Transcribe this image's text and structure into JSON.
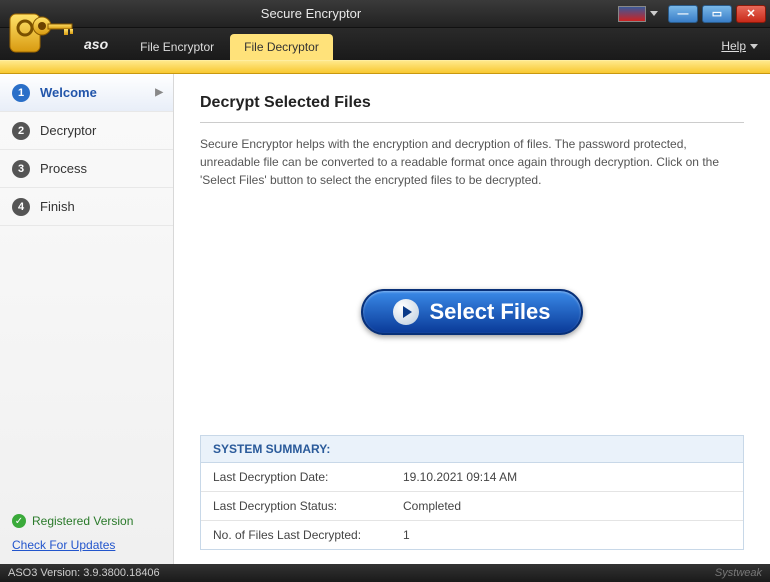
{
  "window": {
    "title": "Secure Encryptor"
  },
  "brand": "aso",
  "tabs": {
    "encryptor": "File Encryptor",
    "decryptor": "File Decryptor"
  },
  "help": "Help",
  "steps": [
    {
      "label": "Welcome"
    },
    {
      "label": "Decryptor"
    },
    {
      "label": "Process"
    },
    {
      "label": "Finish"
    }
  ],
  "sidebar": {
    "registered": "Registered Version",
    "check_updates": "Check For Updates"
  },
  "main": {
    "heading": "Decrypt Selected Files",
    "description": "Secure Encryptor helps with the encryption and decryption of files. The password protected, unreadable file can be converted to a readable format once again through decryption. Click on the 'Select Files' button to select the encrypted files to be decrypted.",
    "select_button": "Select Files"
  },
  "summary": {
    "title": "SYSTEM SUMMARY:",
    "rows": [
      {
        "label": "Last Decryption Date:",
        "value": "19.10.2021 09:14 AM"
      },
      {
        "label": "Last Decryption Status:",
        "value": "Completed"
      },
      {
        "label": "No. of Files Last Decrypted:",
        "value": "1"
      }
    ]
  },
  "statusbar": {
    "version": "ASO3 Version: 3.9.3800.18406",
    "watermark": "Systweak"
  }
}
